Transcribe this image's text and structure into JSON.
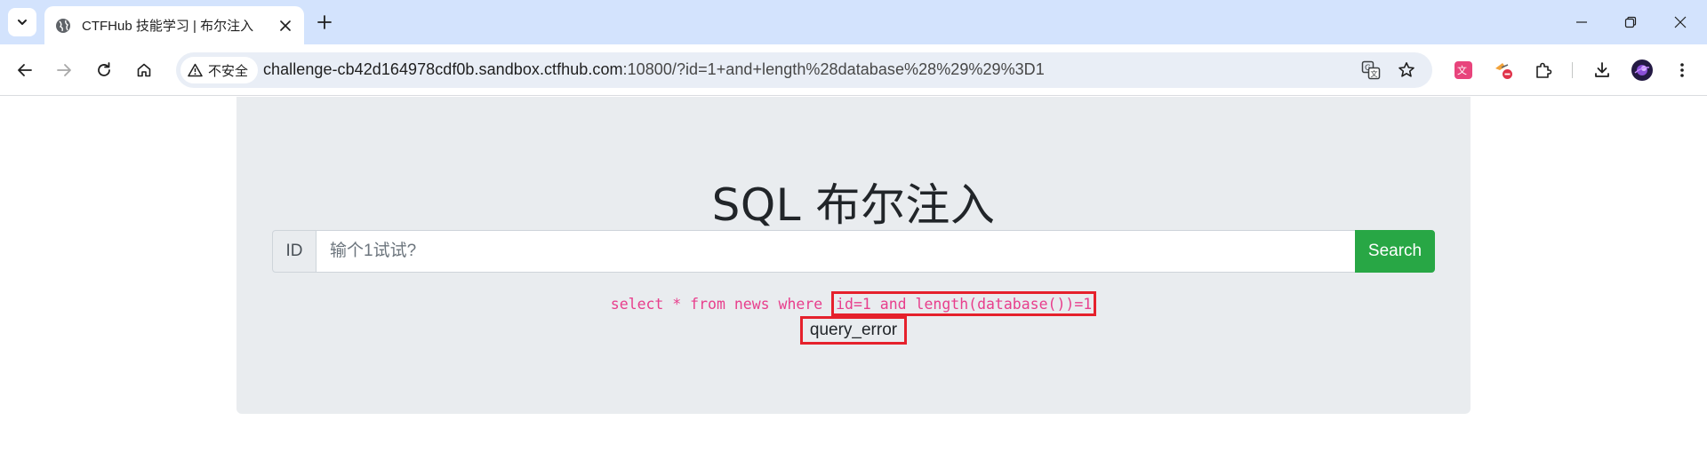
{
  "browser": {
    "tab": {
      "title": "CTFHub 技能学习 | 布尔注入"
    },
    "security_label": "不安全",
    "url_host": "challenge-cb42d164978cdf0b.sandbox.ctfhub.com",
    "url_rest": ":10800/?id=1+and+length%28database%28%29%29%3D1",
    "accent_color": "#d3e3fd"
  },
  "page": {
    "title": "SQL 布尔注入",
    "id_label": "ID",
    "input_placeholder": "输个1试试?",
    "search_label": "Search",
    "query_prefix": "select * from news where ",
    "query_highlight": "id=1 and length(database())=1",
    "result": "query_error",
    "colors": {
      "background": "#e9ecef",
      "button": "#28a745",
      "code": "#e83e8c",
      "highlight": "#e5212c"
    }
  }
}
